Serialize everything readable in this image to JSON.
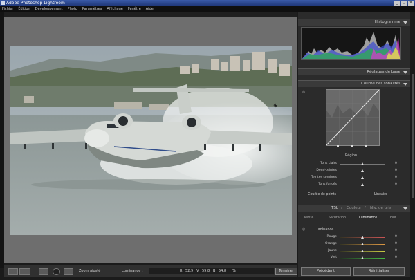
{
  "app": {
    "title": "Adobe Photoshop Lightroom",
    "win_buttons": [
      "_",
      "□",
      "×"
    ]
  },
  "menu": [
    "Fichier",
    "Édition",
    "Développement",
    "Photo",
    "Paramètres",
    "Affichage",
    "Fenêtre",
    "Aide"
  ],
  "panels": {
    "histogram": {
      "title": "Histogramme"
    },
    "basic": {
      "title": "Réglages de base"
    },
    "tone_curve": {
      "title": "Courbe des tonalités",
      "region_label": "Région",
      "sliders": [
        {
          "label": "Tons clairs",
          "value": "0",
          "level": 0.5
        },
        {
          "label": "Demi-teintes",
          "value": "0",
          "level": 0.5
        },
        {
          "label": "Teintes sombres",
          "value": "0",
          "level": 0.5
        },
        {
          "label": "Tons foncés",
          "value": "0",
          "level": 0.5
        }
      ],
      "point_curve_label": "Courbe de points :",
      "point_curve_value": "Linéaire"
    },
    "hsl": {
      "tabs": [
        "TSL",
        "/",
        "Couleur",
        "/",
        "Niv. de gris"
      ],
      "subtabs": [
        "Teinte",
        "Saturation",
        "Luminance",
        "Tout"
      ],
      "section": "Luminance",
      "sliders": [
        {
          "label": "Rouge",
          "value": "0",
          "level": 0.5
        },
        {
          "label": "Orange",
          "value": "0",
          "level": 0.5
        },
        {
          "label": "Jaune",
          "value": "0",
          "level": 0.5
        },
        {
          "label": "Vert",
          "value": "0",
          "level": 0.5
        }
      ]
    }
  },
  "toolbar": {
    "zoom_label": "Zoom ajusté",
    "luminance_label": "Luminance :",
    "readout": {
      "r_label": "R",
      "r_value": "52,9",
      "v_label": "V",
      "v_value": "59,8",
      "b_label": "B",
      "b_value": "54,8",
      "pct": "%"
    },
    "done_label": "Terminer"
  },
  "buttons": {
    "previous": "Précédent",
    "reset": "Réinitialiser"
  },
  "colors": {
    "accent": "#3a5aa8",
    "panel": "#2b2b2b",
    "viewer": "#6e6e6e"
  }
}
